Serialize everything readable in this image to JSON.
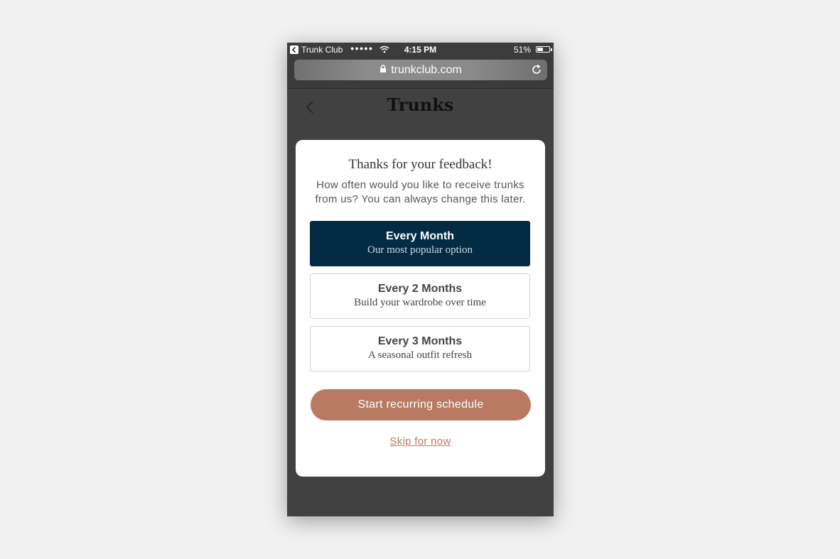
{
  "status_bar": {
    "back_app": "Trunk Club",
    "signal": "●●●●●",
    "time": "4:15 PM",
    "battery": "51%",
    "battery_level_percent": 51
  },
  "browser": {
    "url": "trunkclub.com"
  },
  "nav": {
    "title": "Trunks"
  },
  "modal": {
    "title": "Thanks for your feedback!",
    "subtitle": "How often would you like to receive trunks from us? You can always change this later.",
    "options": [
      {
        "label": "Every Month",
        "description": "Our most popular option",
        "selected": true
      },
      {
        "label": "Every 2 Months",
        "description": "Build your wardrobe over time",
        "selected": false
      },
      {
        "label": "Every 3 Months",
        "description": "A seasonal outfit refresh",
        "selected": false
      }
    ],
    "cta_label": "Start recurring schedule",
    "skip_label": "Skip for now"
  },
  "colors": {
    "selected_option": "#032b44",
    "accent": "#b97a63",
    "background": "#414141"
  },
  "icons": {
    "back_app": "back-arrow-icon",
    "wifi": "wifi-icon",
    "battery": "battery-icon",
    "lock": "lock-icon",
    "reload": "reload-icon",
    "back": "chevron-left-icon"
  }
}
